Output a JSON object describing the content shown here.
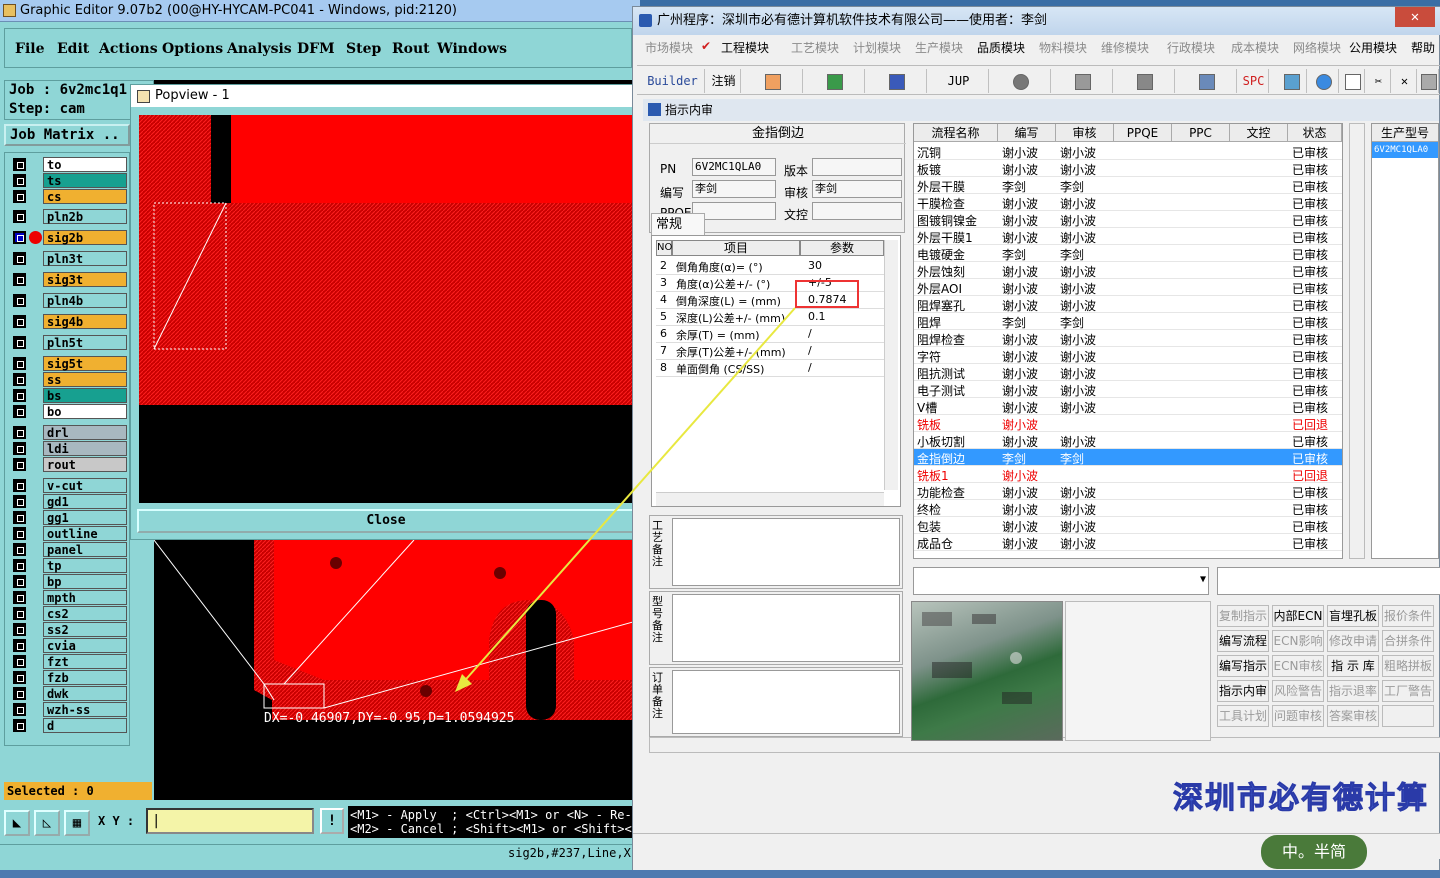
{
  "genesis": {
    "title": "Graphic Editor 9.07b2 (00@HY-HYCAM-PC041 - Windows, pid:2120)",
    "menu": [
      "File",
      "Edit",
      "Actions",
      "Options",
      "Analysis",
      "DFM",
      "Step",
      "Rout",
      "Windows"
    ],
    "job_label": "Job  :  6v2mc1q1",
    "step_label": "Step: cam",
    "job_matrix_label": "Job Matrix ..",
    "layers": [
      {
        "name": "to",
        "color": "#ffffff"
      },
      {
        "name": "ts",
        "color": "#17a090"
      },
      {
        "name": "cs",
        "color": "#f0b030"
      },
      {
        "name": "pln2b",
        "color": "#8fd6d6"
      },
      {
        "name": "sig2b",
        "color": "#f0b030"
      },
      {
        "name": "pln3t",
        "color": "#8fd6d6"
      },
      {
        "name": "sig3t",
        "color": "#f0b030"
      },
      {
        "name": "pln4b",
        "color": "#8fd6d6"
      },
      {
        "name": "sig4b",
        "color": "#f0b030"
      },
      {
        "name": "pln5t",
        "color": "#8fd6d6"
      },
      {
        "name": "sig5t",
        "color": "#f0b030"
      },
      {
        "name": "ss",
        "color": "#f0b030"
      },
      {
        "name": "bs",
        "color": "#17a090"
      },
      {
        "name": "bo",
        "color": "#ffffff"
      },
      {
        "name": "drl",
        "color": "#a8b8c0"
      },
      {
        "name": "ldi",
        "color": "#a8b8c0"
      },
      {
        "name": "rout",
        "color": "#c8c8c8"
      },
      {
        "name": "v-cut",
        "color": "#8fd6d6"
      },
      {
        "name": "gd1",
        "color": "#8fd6d6"
      },
      {
        "name": "gg1",
        "color": "#8fd6d6"
      },
      {
        "name": "outline",
        "color": "#8fd6d6"
      },
      {
        "name": "panel",
        "color": "#8fd6d6"
      },
      {
        "name": "tp",
        "color": "#8fd6d6"
      },
      {
        "name": "bp",
        "color": "#8fd6d6"
      },
      {
        "name": "mpth",
        "color": "#8fd6d6"
      },
      {
        "name": "cs2",
        "color": "#8fd6d6"
      },
      {
        "name": "ss2",
        "color": "#8fd6d6"
      },
      {
        "name": "cvia",
        "color": "#8fd6d6"
      },
      {
        "name": "fzt",
        "color": "#8fd6d6"
      },
      {
        "name": "fzb",
        "color": "#8fd6d6"
      },
      {
        "name": "dwk",
        "color": "#8fd6d6"
      },
      {
        "name": "wzh-ss",
        "color": "#8fd6d6"
      },
      {
        "name": "d",
        "color": "#8fd6d6"
      }
    ],
    "selected_label": "Selected : 0",
    "xy_label": "X Y :",
    "hint": "<M1> - Apply  ; <Ctrl><M1> or <N> - Re-s\n<M2> - Cancel ; <Shift><M1> or <Shift><N",
    "status": "sig2b,#237,Line,X",
    "measure": "DX=-0.46907,DY=-0.95,D=1.0594925",
    "popview": {
      "title": "Popview - 1",
      "close_label": "Close"
    }
  },
  "app": {
    "title": "广州程序：深圳市必有德计算机软件技术有限公司——使用者：李剑",
    "close_icon": "close-icon",
    "modules": [
      {
        "label": "市场模块",
        "active": false
      },
      {
        "label": "工程模块",
        "active": true
      },
      {
        "label": "工艺模块",
        "active": false
      },
      {
        "label": "计划模块",
        "active": false
      },
      {
        "label": "生产模块",
        "active": false
      },
      {
        "label": "品质模块",
        "active": true
      },
      {
        "label": "物料模块",
        "active": false
      },
      {
        "label": "维修模块",
        "active": false
      },
      {
        "label": "行政模块",
        "active": false
      },
      {
        "label": "成本模块",
        "active": false
      },
      {
        "label": "网络模块",
        "active": false
      },
      {
        "label": "公用模块",
        "active": true
      },
      {
        "label": "帮助",
        "active": true
      }
    ],
    "tools": [
      "Builder",
      "注销",
      "JUP",
      "SPC"
    ],
    "sub_title": "指示内审",
    "form": {
      "title": "金指倒边",
      "pn_label": "PN",
      "pn": "6V2MC1QLA0",
      "ver_label": "版本",
      "ver": "",
      "author_label": "编写",
      "author": "李剑",
      "review_label": "审核",
      "review": "李剑",
      "ppqe_label": "PPQE",
      "ppqe": "",
      "doc_label": "文控",
      "doc": ""
    },
    "tab_normal": "常规",
    "params": {
      "headers": [
        "NO",
        "项目",
        "参数"
      ],
      "rows": [
        {
          "no": "2",
          "item": "倒角角度(α)=  (°)",
          "val": "30"
        },
        {
          "no": "3",
          "item": "角度(α)公差+/-  (°)",
          "val": "+/-5"
        },
        {
          "no": "4",
          "item": "倒角深度(L) =  (mm)",
          "val": "0.7874"
        },
        {
          "no": "5",
          "item": "深度(L)公差+/-  (mm)",
          "val": "0.1"
        },
        {
          "no": "6",
          "item": "余厚(T) =  (mm)",
          "val": "/"
        },
        {
          "no": "7",
          "item": "余厚(T)公差+/-  (mm)",
          "val": "/"
        },
        {
          "no": "8",
          "item": "单面倒角 (CS/SS)",
          "val": "/"
        }
      ]
    },
    "notes": [
      "工艺备注",
      "型号备注",
      "订单备注"
    ],
    "flow": {
      "headers": [
        "流程名称",
        "编写",
        "审核",
        "PPQE",
        "PPC",
        "文控",
        "状态"
      ],
      "rows": [
        {
          "name": "沉铜",
          "w": "谢小波",
          "r": "谢小波",
          "s": "已审核"
        },
        {
          "name": "板镀",
          "w": "谢小波",
          "r": "谢小波",
          "s": "已审核"
        },
        {
          "name": "外层干膜",
          "w": "李剑",
          "r": "李剑",
          "s": "已审核"
        },
        {
          "name": "干膜检查",
          "w": "谢小波",
          "r": "谢小波",
          "s": "已审核"
        },
        {
          "name": "图镀铜镍金",
          "w": "谢小波",
          "r": "谢小波",
          "s": "已审核"
        },
        {
          "name": "外层干膜1",
          "w": "谢小波",
          "r": "谢小波",
          "s": "已审核"
        },
        {
          "name": "电镀硬金",
          "w": "李剑",
          "r": "李剑",
          "s": "已审核"
        },
        {
          "name": "外层蚀刻",
          "w": "谢小波",
          "r": "谢小波",
          "s": "已审核"
        },
        {
          "name": "外层AOI",
          "w": "谢小波",
          "r": "谢小波",
          "s": "已审核"
        },
        {
          "name": "阻焊塞孔",
          "w": "谢小波",
          "r": "谢小波",
          "s": "已审核"
        },
        {
          "name": "阻焊",
          "w": "李剑",
          "r": "李剑",
          "s": "已审核"
        },
        {
          "name": "阻焊检查",
          "w": "谢小波",
          "r": "谢小波",
          "s": "已审核"
        },
        {
          "name": "字符",
          "w": "谢小波",
          "r": "谢小波",
          "s": "已审核"
        },
        {
          "name": "阻抗测试",
          "w": "谢小波",
          "r": "谢小波",
          "s": "已审核"
        },
        {
          "name": "电子测试",
          "w": "谢小波",
          "r": "谢小波",
          "s": "已审核"
        },
        {
          "name": "V槽",
          "w": "谢小波",
          "r": "谢小波",
          "s": "已审核"
        },
        {
          "name": "铣板",
          "w": "谢小波",
          "r": "",
          "s": "已回退",
          "red": true
        },
        {
          "name": "小板切割",
          "w": "谢小波",
          "r": "谢小波",
          "s": "已审核"
        },
        {
          "name": "金指倒边",
          "w": "李剑",
          "r": "李剑",
          "s": "已审核",
          "sel": true
        },
        {
          "name": "铣板1",
          "w": "谢小波",
          "r": "",
          "s": "已回退",
          "red": true
        },
        {
          "name": "功能检查",
          "w": "谢小波",
          "r": "谢小波",
          "s": "已审核"
        },
        {
          "name": "终检",
          "w": "谢小波",
          "r": "谢小波",
          "s": "已审核"
        },
        {
          "name": "包装",
          "w": "谢小波",
          "r": "谢小波",
          "s": "已审核"
        },
        {
          "name": "成品仓",
          "w": "谢小波",
          "r": "谢小波",
          "s": "已审核"
        }
      ]
    },
    "model_header": "生产型号",
    "model_value": "6V2MC1QLA0",
    "buttons": [
      {
        "label": "复制指示",
        "dis": true
      },
      {
        "label": "内部ECN",
        "dis": false
      },
      {
        "label": "盲埋孔板",
        "dis": false
      },
      {
        "label": "报价条件",
        "dis": true
      },
      {
        "label": "编写流程",
        "dis": false
      },
      {
        "label": "ECN影响",
        "dis": true
      },
      {
        "label": "修改申请",
        "dis": true
      },
      {
        "label": "合拼条件",
        "dis": true
      },
      {
        "label": "编写指示",
        "dis": false
      },
      {
        "label": "ECN审核",
        "dis": true
      },
      {
        "label": "指 示 库",
        "dis": false
      },
      {
        "label": "粗略拼板",
        "dis": true
      },
      {
        "label": "指示内审",
        "dis": false
      },
      {
        "label": "风险警告",
        "dis": true
      },
      {
        "label": "指示退率",
        "dis": true
      },
      {
        "label": "工厂警告",
        "dis": true
      },
      {
        "label": "工具计划",
        "dis": true
      },
      {
        "label": "问题审核",
        "dis": true
      },
      {
        "label": "答案审核",
        "dis": true
      },
      {
        "label": "",
        "dis": true
      }
    ],
    "banner": "深圳市必有德计算",
    "ime": "中。半简"
  }
}
